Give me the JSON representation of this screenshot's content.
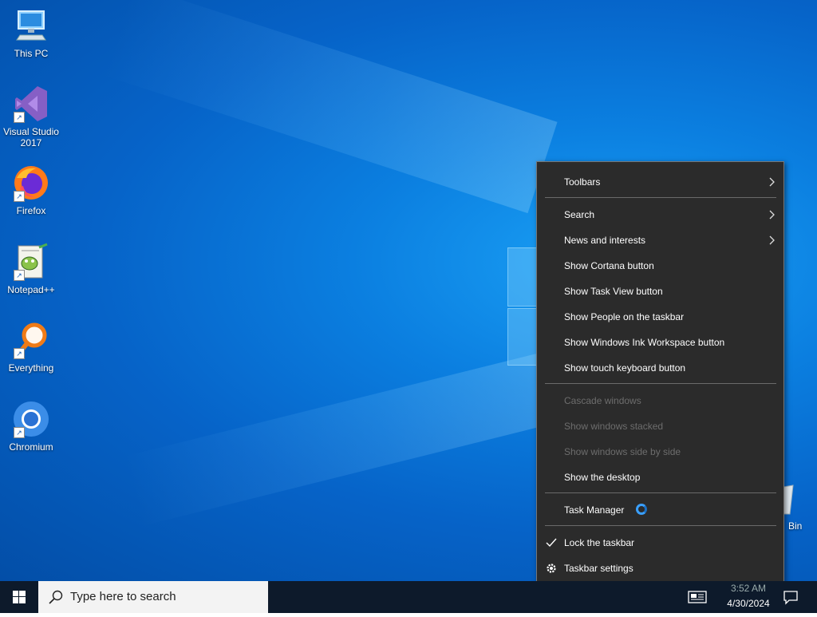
{
  "desktop": {
    "icons": [
      {
        "label": "This PC",
        "name": "this-pc"
      },
      {
        "label": "Visual Studio 2017",
        "name": "visual-studio-2017"
      },
      {
        "label": "Firefox",
        "name": "firefox"
      },
      {
        "label": "Notepad++",
        "name": "notepad-plus-plus"
      },
      {
        "label": "Everything",
        "name": "everything"
      },
      {
        "label": "Chromium",
        "name": "chromium"
      }
    ],
    "recycle_bin_label": "Bin"
  },
  "context_menu": {
    "items": [
      {
        "label": "Toolbars",
        "enabled": true,
        "submenu": true
      },
      {
        "label": "Search",
        "enabled": true,
        "submenu": true
      },
      {
        "label": "News and interests",
        "enabled": true,
        "submenu": true
      },
      {
        "label": "Show Cortana button",
        "enabled": true
      },
      {
        "label": "Show Task View button",
        "enabled": true
      },
      {
        "label": "Show People on the taskbar",
        "enabled": true
      },
      {
        "label": "Show Windows Ink Workspace button",
        "enabled": true
      },
      {
        "label": "Show touch keyboard button",
        "enabled": true
      },
      {
        "label": "Cascade windows",
        "enabled": false
      },
      {
        "label": "Show windows stacked",
        "enabled": false
      },
      {
        "label": "Show windows side by side",
        "enabled": false
      },
      {
        "label": "Show the desktop",
        "enabled": true
      },
      {
        "label": "Task Manager",
        "enabled": true,
        "busy_icon": "loading-spinner-icon"
      },
      {
        "label": "Lock the taskbar",
        "enabled": true,
        "checked": true,
        "lead_icon": "checkmark-icon"
      },
      {
        "label": "Taskbar settings",
        "enabled": true,
        "lead_icon": "gear-icon"
      }
    ]
  },
  "taskbar": {
    "search_placeholder": "Type here to search",
    "clock_time": "3:52 AM",
    "clock_date": "4/30/2024"
  },
  "colors": {
    "menu_bg": "#2b2b2b",
    "taskbar_bg": "#0d1a2b",
    "disabled_text": "#6d6d6d",
    "accent": "#3aa0ff"
  }
}
